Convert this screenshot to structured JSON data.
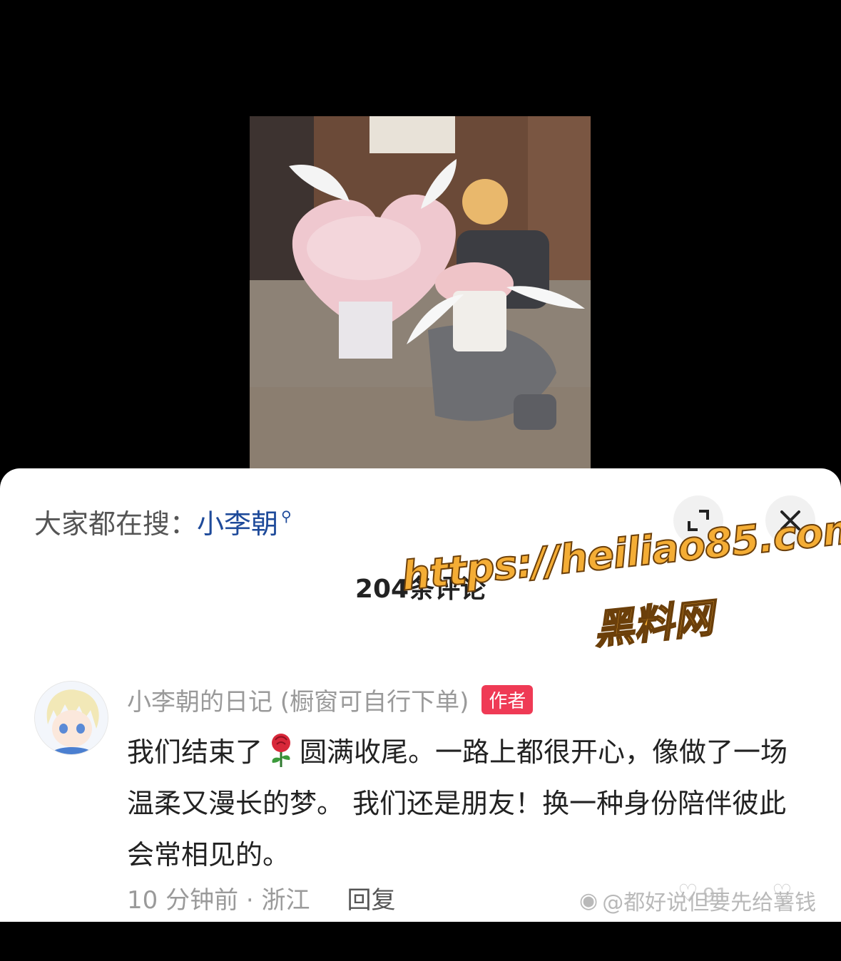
{
  "search": {
    "prefix": "大家都在搜：",
    "keyword": "小李朝"
  },
  "comments_header": {
    "count_label": "204条评论"
  },
  "watermark": {
    "url": "https://heiliao85.com",
    "name": "黑料网"
  },
  "comment": {
    "author": "小李朝的日记 (橱窗可自行下单)",
    "badge": "作者",
    "text_before_icon": "我们结束了",
    "text_after_icon": "圆满收尾。一路上都很开心，像做了一场温柔又漫长的梦。 我们还是朋友！换一种身份陪伴彼此会常相见的。",
    "time_location": "10 分钟前 · 浙江",
    "reply_label": "回复",
    "like_count": "91"
  },
  "footer": {
    "weibo_mark": "@都好说但要先给薯钱"
  },
  "icons": {
    "search": "search-icon",
    "expand": "expand-icon",
    "close": "close-icon",
    "rose": "rose-icon",
    "like": "heart-icon",
    "weibo": "weibo-icon"
  },
  "colors": {
    "keyword": "#1e4a9a",
    "badge": "#ef3a55",
    "watermark_fill": "#f4ad35"
  }
}
